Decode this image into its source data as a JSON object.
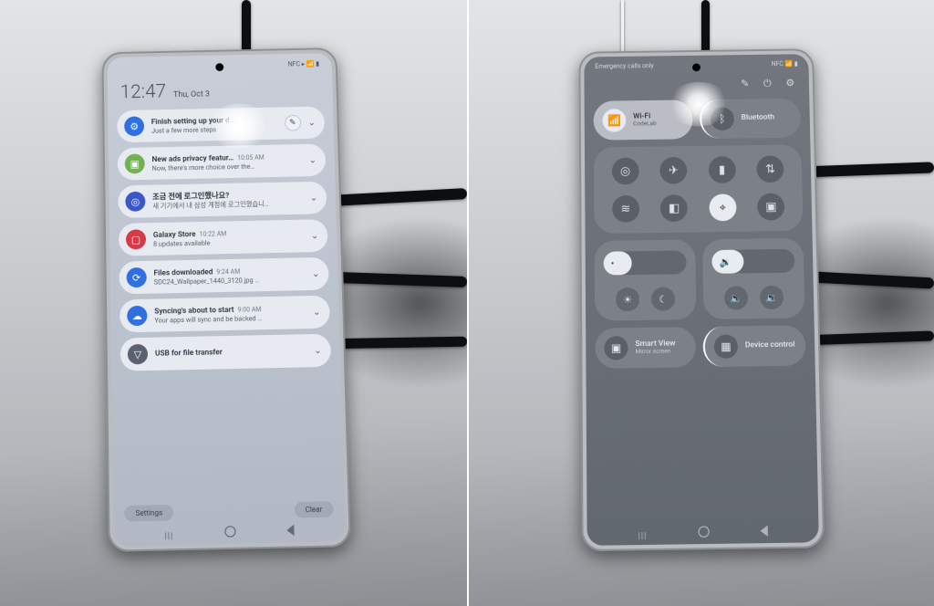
{
  "left": {
    "status_icons": "NFC ▸ 📶 ▮",
    "time": "12:47",
    "date": "Thu, Oct 3",
    "notifications": [
      {
        "icon": "⚙",
        "icon_bg": "#2f6fe0",
        "title": "Finish setting up your d…",
        "subtitle": "Just a few more steps",
        "badge_wand": true
      },
      {
        "icon": "▣",
        "icon_bg": "#6fb24e",
        "title": "New ads privacy featur…",
        "time": "10:05 AM",
        "subtitle": "Now, there's more choice over the…"
      },
      {
        "icon": "◎",
        "icon_bg": "#3a56c9",
        "title": "조금 전에 로그인했나요?",
        "subtitle": "새 기기에서 내 삼성 계정에 로그인했습니…"
      },
      {
        "icon": "▢",
        "icon_bg": "#d43a47",
        "title": "Galaxy Store",
        "time": "10:22 AM",
        "subtitle": "8 updates available"
      },
      {
        "icon": "⟳",
        "icon_bg": "#2f6fe0",
        "title": "Files downloaded",
        "time": "9:24 AM",
        "subtitle": "SDC24_Wallpaper_1440_3120.jpg …"
      },
      {
        "icon": "☁",
        "icon_bg": "#2f6fe0",
        "title": "Syncing's about to start",
        "time": "9:00 AM",
        "subtitle": "Your apps will sync and be backed …"
      },
      {
        "icon": "▽",
        "icon_bg": "#5a6270",
        "title": "USB for file transfer",
        "single": true
      }
    ],
    "settings_btn": "Settings",
    "clear_btn": "Clear"
  },
  "right": {
    "status_left": "Emergency calls only",
    "status_right": "NFC 📶 ▮",
    "top_icons": {
      "edit": "✎",
      "power": "⏻",
      "settings": "⚙"
    },
    "wifi": {
      "label": "Wi-Fi",
      "sub": "CodeLab",
      "on": true
    },
    "bluetooth": {
      "label": "Bluetooth",
      "on": false
    },
    "grid": [
      {
        "name": "auto-rotate",
        "glyph": "◎",
        "on": false
      },
      {
        "name": "airplane",
        "glyph": "✈",
        "on": false
      },
      {
        "name": "flashlight",
        "glyph": "▮",
        "on": false
      },
      {
        "name": "data-sync",
        "glyph": "⇅",
        "on": false
      },
      {
        "name": "hotspot",
        "glyph": "≋",
        "on": false
      },
      {
        "name": "power-save",
        "glyph": "◧",
        "on": false
      },
      {
        "name": "location",
        "glyph": "⌖",
        "on": true
      },
      {
        "name": "multi-window",
        "glyph": "▣",
        "on": false
      }
    ],
    "brightness": {
      "percent": 34
    },
    "brightness_btns": [
      {
        "name": "auto-brightness",
        "glyph": "☀"
      },
      {
        "name": "dark-mode",
        "glyph": "☾"
      }
    ],
    "volume": {
      "percent": 38
    },
    "volume_btns": [
      {
        "name": "sound-output",
        "glyph": "🔈"
      },
      {
        "name": "sound-mode",
        "glyph": "🔉"
      }
    ],
    "smartview": {
      "label": "Smart View",
      "sub": "Mirror screen"
    },
    "devicecontrol": {
      "label": "Device control"
    }
  }
}
